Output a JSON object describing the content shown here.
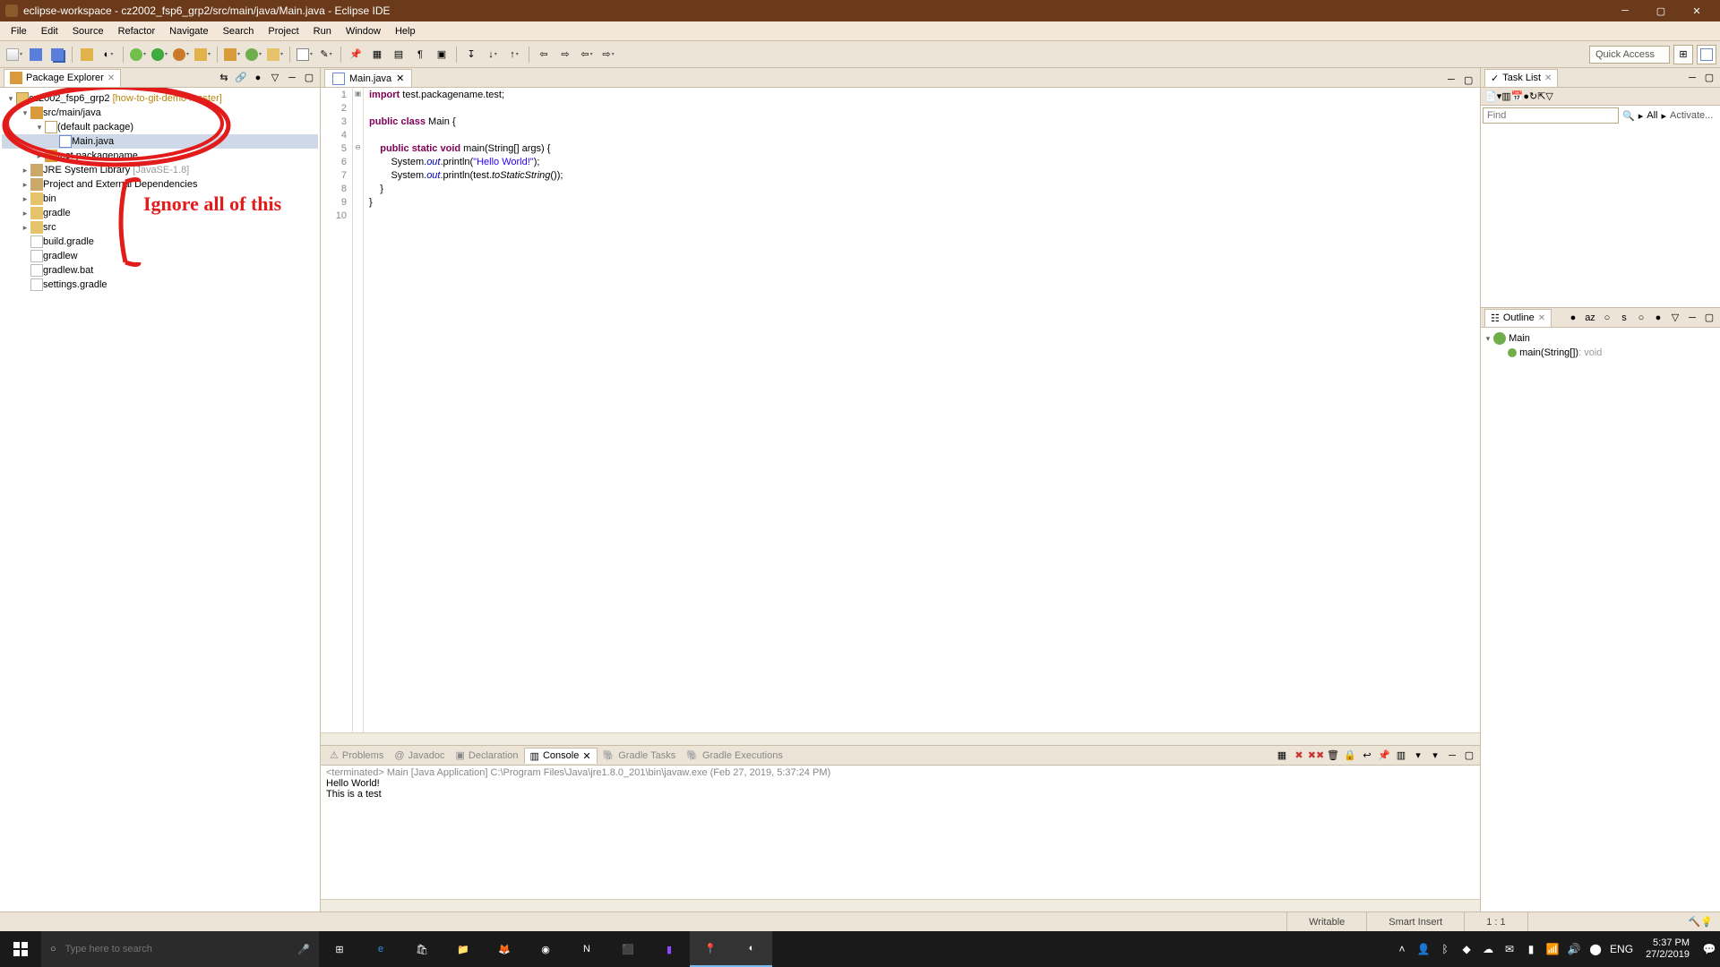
{
  "window": {
    "title": "eclipse-workspace - cz2002_fsp6_grp2/src/main/java/Main.java - Eclipse IDE"
  },
  "menu": [
    "File",
    "Edit",
    "Source",
    "Refactor",
    "Navigate",
    "Search",
    "Project",
    "Run",
    "Window",
    "Help"
  ],
  "quick_access": "Quick Access",
  "package_explorer": {
    "title": "Package Explorer",
    "project": {
      "name": "cz2002_fsp6_grp2",
      "decor": "[how-to-git-demo master]"
    },
    "srcfolder": "src/main/java",
    "default_pkg": "(default package)",
    "main_file": "Main.java",
    "test_pkg": "test.packagename",
    "jre": {
      "name": "JRE System Library",
      "decor": "[JavaSE-1.8]"
    },
    "deps": "Project and External Dependencies",
    "bin": "bin",
    "gradle": "gradle",
    "src": "src",
    "build_gradle": "build.gradle",
    "gradlew": "gradlew",
    "gradlew_bat": "gradlew.bat",
    "settings_gradle": "settings.gradle"
  },
  "annotation": "Ignore all of this",
  "editor": {
    "tab": "Main.java",
    "lines": {
      "1": "import test.packagename.test;",
      "2": "",
      "3": "public class Main {",
      "4": "",
      "5": "    public static void main(String[] args) {",
      "6": "        System.out.println(\"Hello World!\");",
      "7": "        System.out.println(test.toStaticString());",
      "8": "    }",
      "9": "}",
      "10": ""
    }
  },
  "tasklist": {
    "title": "Task List",
    "find_placeholder": "Find",
    "all": "All",
    "activate": "Activate..."
  },
  "outline": {
    "title": "Outline",
    "class": "Main",
    "method": "main(String[])",
    "method_type": ": void"
  },
  "bottom": {
    "tabs": [
      "Problems",
      "Javadoc",
      "Declaration",
      "Console",
      "Gradle Tasks",
      "Gradle Executions"
    ],
    "console_meta": "<terminated> Main [Java Application] C:\\Program Files\\Java\\jre1.8.0_201\\bin\\javaw.exe (Feb 27, 2019, 5:37:24 PM)",
    "console_l1": "Hello World!",
    "console_l2": "This is a test"
  },
  "status": {
    "writable": "Writable",
    "insert": "Smart Insert",
    "pos": "1 : 1"
  },
  "taskbar": {
    "search_placeholder": "Type here to search",
    "lang": "ENG",
    "time": "5:37 PM",
    "date": "27/2/2019"
  }
}
